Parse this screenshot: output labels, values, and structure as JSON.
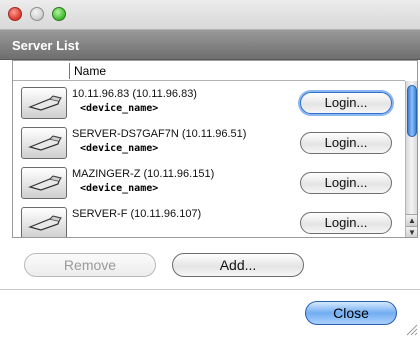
{
  "window": {
    "section_title": "Server List"
  },
  "list": {
    "column_header": "Name",
    "rows": [
      {
        "title": "10.11.96.83 (10.11.96.83)",
        "subtitle": "<device_name>",
        "login_label": "Login..."
      },
      {
        "title": "SERVER-DS7GAF7N (10.11.96.51)",
        "subtitle": "<device_name>",
        "login_label": "Login..."
      },
      {
        "title": "MAZINGER-Z (10.11.96.151)",
        "subtitle": "<device_name>",
        "login_label": "Login..."
      },
      {
        "title": "SERVER-F (10.11.96.107)",
        "subtitle": "",
        "login_label": "Login..."
      }
    ]
  },
  "actions": {
    "remove_label": "Remove",
    "add_label": "Add...",
    "close_label": "Close"
  },
  "icons": {
    "device": "device-icon",
    "window_close": "close-window-icon",
    "window_minimize": "minimize-window-icon",
    "window_zoom": "zoom-window-icon",
    "scroll_up": "scroll-up-arrow-icon",
    "scroll_down": "scroll-down-arrow-icon",
    "resize": "resize-grip-icon"
  },
  "colors": {
    "accent": "#73adf2",
    "header_bg": "#7f7f7f"
  }
}
